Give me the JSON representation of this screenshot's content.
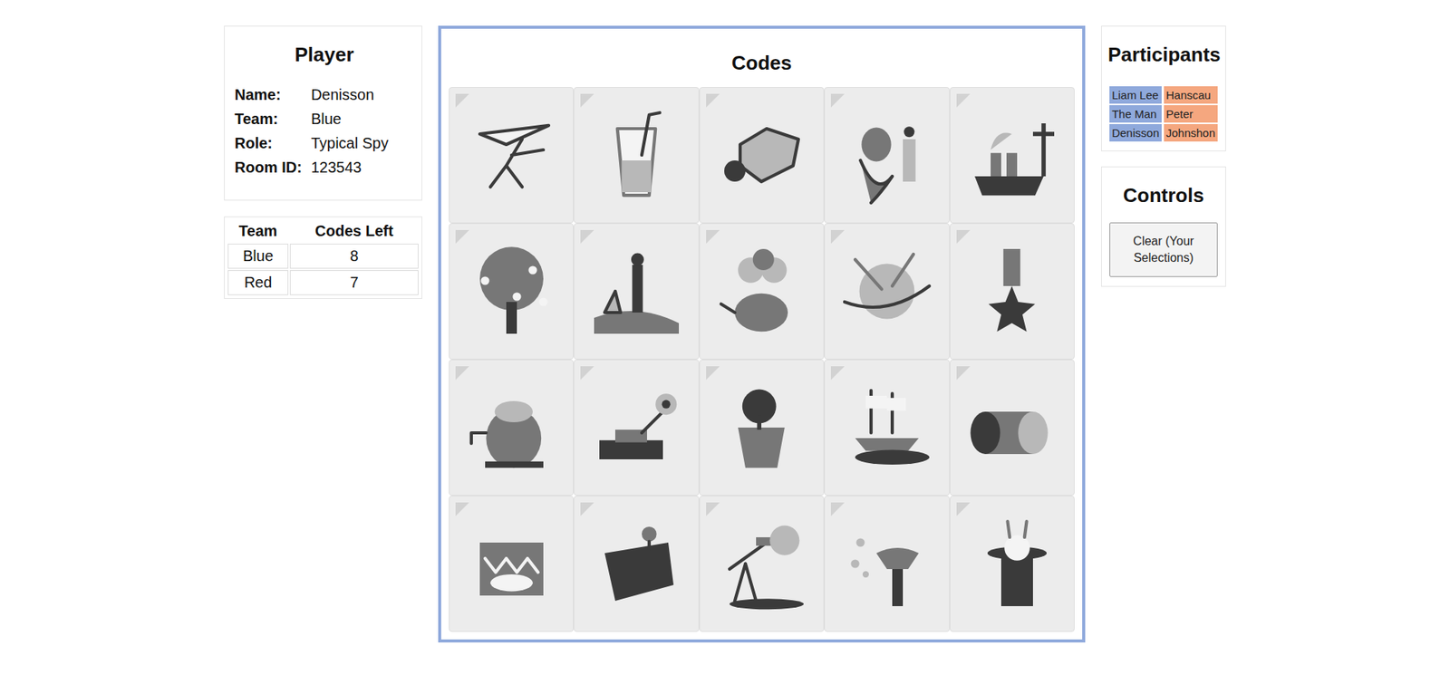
{
  "player": {
    "title": "Player",
    "fields": [
      {
        "label": "Name:",
        "value": "Denisson"
      },
      {
        "label": "Team:",
        "value": "Blue"
      },
      {
        "label": "Role:",
        "value": "Typical Spy"
      },
      {
        "label": "Room ID:",
        "value": "123543"
      }
    ]
  },
  "codes_left": {
    "columns": [
      "Team",
      "Codes Left"
    ],
    "rows": [
      {
        "team": "Blue",
        "count": "8"
      },
      {
        "team": "Red",
        "count": "7"
      }
    ]
  },
  "board": {
    "title": "Codes",
    "cards": [
      {
        "selected": false
      },
      {
        "selected": false
      },
      {
        "selected": false
      },
      {
        "selected": false
      },
      {
        "selected": false
      },
      {
        "selected": false
      },
      {
        "selected": false
      },
      {
        "selected": false
      },
      {
        "selected": false
      },
      {
        "selected": false
      },
      {
        "selected": false
      },
      {
        "selected": false
      },
      {
        "selected": false
      },
      {
        "selected": false
      },
      {
        "selected": false
      },
      {
        "selected": false
      },
      {
        "selected": false
      },
      {
        "selected": false
      },
      {
        "selected": false
      },
      {
        "selected": false
      }
    ]
  },
  "participants": {
    "title": "Participants",
    "columns": [
      {
        "color": "#8fa9dc",
        "members": [
          "Liam Lee",
          "The Man",
          "Denisson"
        ]
      },
      {
        "color": "#f5a77f",
        "members": [
          "Hanscau",
          "Peter",
          "Johnshon"
        ]
      }
    ]
  },
  "controls": {
    "title": "Controls",
    "buttons": [
      "Clear (Your Selections)"
    ]
  }
}
